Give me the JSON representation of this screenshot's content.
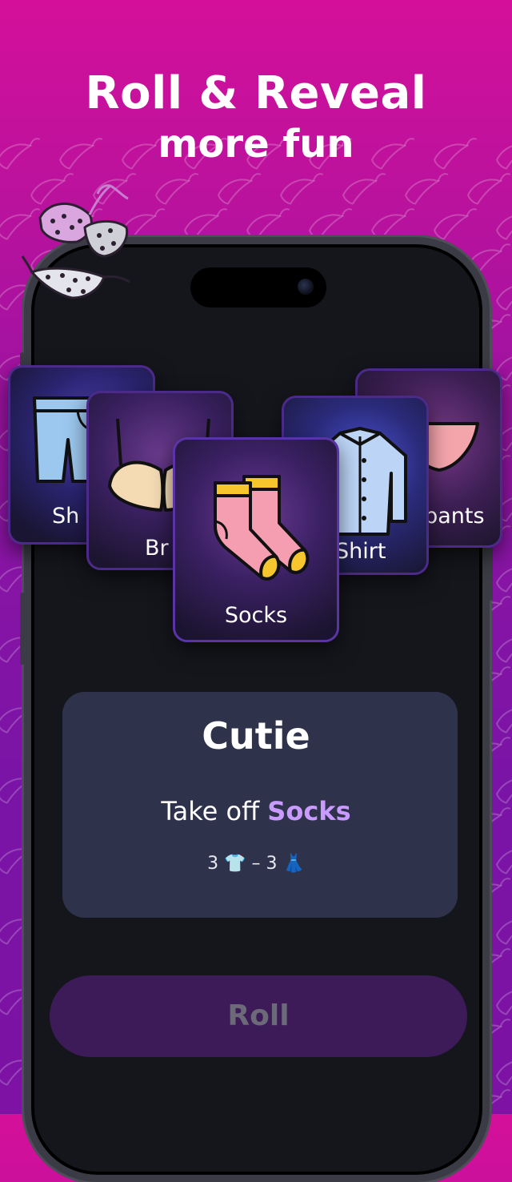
{
  "headline": {
    "line1": "Roll & Reveal",
    "line2": "more fun"
  },
  "cards": [
    {
      "id": "shorts",
      "label": "Sh",
      "icon": "shorts-icon"
    },
    {
      "id": "underpants",
      "label": "rpants",
      "icon": "underpants-icon"
    },
    {
      "id": "bra",
      "label": "Br",
      "icon": "bra-icon"
    },
    {
      "id": "shirt",
      "label": "Shirt",
      "icon": "shirt-icon"
    },
    {
      "id": "socks",
      "label": "Socks",
      "icon": "socks-icon"
    }
  ],
  "result": {
    "title": "Cutie",
    "task_prefix": "Take off ",
    "task_item": "Socks",
    "score_left": "3",
    "score_left_emoji": "👕",
    "score_sep": "–",
    "score_right": "3",
    "score_right_emoji": "👗"
  },
  "roll_button": {
    "label": "Roll"
  },
  "colors": {
    "accent": "#c99bff",
    "button_bg": "#3c1b58",
    "panel_bg": "#2e324a",
    "phone_bg": "#15161c"
  }
}
